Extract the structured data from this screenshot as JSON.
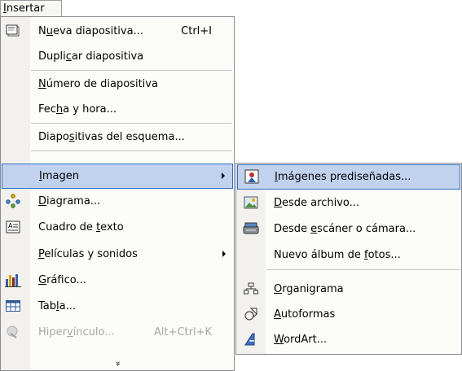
{
  "menubar": {
    "title_ul": "I",
    "title_rest": "nsertar"
  },
  "main_menu": {
    "items": [
      {
        "pre": "N",
        "u": "u",
        "post": "eva diapositiva...",
        "shortcut": "Ctrl+I",
        "icon": "new-slide-icon"
      },
      {
        "pre": "Dupli",
        "u": "c",
        "post": "ar diapositiva",
        "icon": ""
      },
      {
        "pre": "",
        "u": "N",
        "post": "úmero de diapositiva",
        "icon": ""
      },
      {
        "pre": "Fec",
        "u": "h",
        "post": "a y hora...",
        "icon": ""
      },
      {
        "pre": "Diapo",
        "u": "s",
        "post": "itivas del esquema...",
        "icon": ""
      },
      {
        "pre": "",
        "u": "I",
        "post": "magen",
        "icon": "",
        "submenu": true
      },
      {
        "pre": "",
        "u": "D",
        "post": "iagrama...",
        "icon": "diagram-icon"
      },
      {
        "pre": "Cuadro de ",
        "u": "t",
        "post": "exto",
        "icon": "text-box-icon"
      },
      {
        "pre": "",
        "u": "P",
        "post": "elículas y sonidos",
        "icon": "",
        "submenu": true
      },
      {
        "pre": "",
        "u": "G",
        "post": "ráfico...",
        "icon": "chart-icon"
      },
      {
        "pre": "Tab",
        "u": "l",
        "post": "a...",
        "icon": "table-icon"
      },
      {
        "pre": "Hiper",
        "u": "v",
        "post": "ínculo...",
        "shortcut": "Alt+Ctrl+K",
        "icon": "hyperlink-icon",
        "disabled": true
      }
    ],
    "expand_glyph": "»"
  },
  "sub_menu": {
    "items": [
      {
        "pre": "",
        "u": "I",
        "post": "mágenes prediseñadas...",
        "icon": "clip-art-icon"
      },
      {
        "pre": "",
        "u": "D",
        "post": "esde archivo...",
        "icon": "from-file-icon"
      },
      {
        "pre": "Desde ",
        "u": "e",
        "post": "scáner o cámara...",
        "icon": "scanner-icon"
      },
      {
        "pre": "Nuevo álbum de ",
        "u": "f",
        "post": "otos...",
        "icon": ""
      },
      {
        "pre": "",
        "u": "O",
        "post": "rganigrama",
        "icon": "org-chart-icon"
      },
      {
        "pre": "",
        "u": "A",
        "post": "utoformas",
        "icon": "autoshapes-icon"
      },
      {
        "pre": "",
        "u": "W",
        "post": "ordArt...",
        "icon": "wordart-icon"
      }
    ]
  },
  "colors": {
    "highlight_bg": "#c1d2ee",
    "highlight_border": "#316ac5",
    "disabled_text": "#a6a6a6"
  }
}
